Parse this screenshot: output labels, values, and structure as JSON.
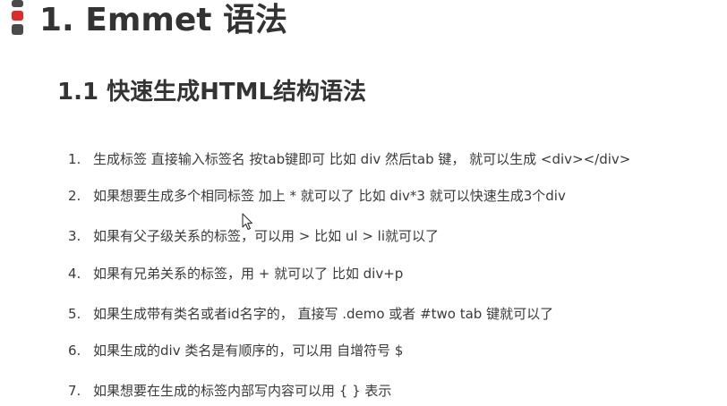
{
  "slide": {
    "main_title": "1. Emmet 语法",
    "section_title": "1.1 快速生成HTML结构语法",
    "marker_colors": [
      "#4a4a4a",
      "#e02a2a",
      "#4a4a4a"
    ],
    "items": [
      {
        "number": "1.",
        "text": "生成标签 直接输入标签名 按tab键即可  比如  div   然后tab 键， 就可以生成 <div></div>"
      },
      {
        "number": "2.",
        "text": "如果想要生成多个相同标签  加上 * 就可以了 比如   div*3  就可以快速生成3个div"
      },
      {
        "number": "3.",
        "text": "如果有父子级关系的标签，可以用 >  比如    ul > li就可以了"
      },
      {
        "number": "4.",
        "text": "如果有兄弟关系的标签，用  +  就可以了 比如 div+p"
      },
      {
        "number": "5.",
        "text": "如果生成带有类名或者id名字的，  直接写  .demo  或者  #two    tab 键就可以了"
      },
      {
        "number": "6.",
        "text": "如果生成的div 类名是有顺序的，可以用 自增符号  $"
      },
      {
        "number": "7.",
        "text": "如果想要在生成的标签内部写内容可以用 { } 表示"
      }
    ]
  }
}
